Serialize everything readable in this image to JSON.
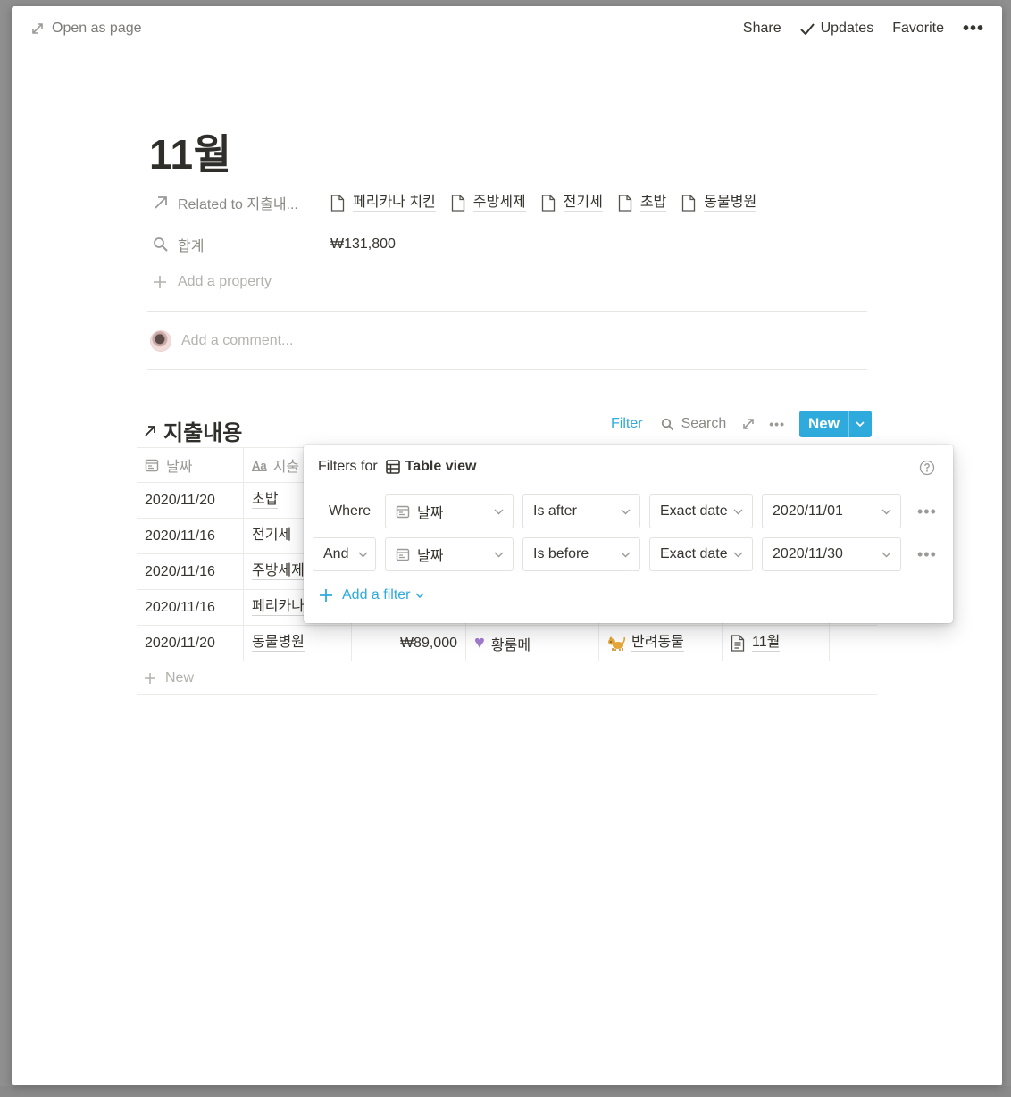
{
  "topbar": {
    "open_as_page": "Open as page",
    "share": "Share",
    "updates": "Updates",
    "favorite": "Favorite",
    "more": "•••"
  },
  "page": {
    "title": "11월",
    "properties": {
      "related": {
        "label": "Related to 지출내...",
        "items": [
          "페리카나 치킨",
          "주방세제",
          "전기세",
          "초밥",
          "동물병원"
        ]
      },
      "total": {
        "label": "합계",
        "value": "₩131,800"
      }
    },
    "add_property": "Add a property",
    "comment_placeholder": "Add a comment..."
  },
  "database": {
    "title": "지출내용",
    "filter": "Filter",
    "search": "Search",
    "more": "•••",
    "new_button": "New",
    "columns": {
      "date": "날짜",
      "name": "지출"
    },
    "rows": [
      {
        "date": "2020/11/20",
        "name": "초밥"
      },
      {
        "date": "2020/11/16",
        "name": "전기세"
      },
      {
        "date": "2020/11/16",
        "name": "주방세제"
      },
      {
        "date": "2020/11/16",
        "name": "페리카나"
      },
      {
        "date": "2020/11/20",
        "name": "동물병원",
        "amount": "₩89,000",
        "category": "황룸메",
        "type": "반려동물",
        "month": "11월"
      }
    ],
    "add_row": "New"
  },
  "filter_popup": {
    "title": "Filters for",
    "view_name": "Table view",
    "rules": [
      {
        "conjunction": "Where",
        "property": "날짜",
        "operator": "Is after",
        "kind": "Exact date",
        "value": "2020/11/01"
      },
      {
        "conjunction": "And",
        "property": "날짜",
        "operator": "Is before",
        "kind": "Exact date",
        "value": "2020/11/30"
      }
    ],
    "add_filter": "Add a filter",
    "row_menu": "•••"
  },
  "colors": {
    "accent": "#2eaadc",
    "text": "#37352f",
    "muted": "#9b9a97"
  }
}
